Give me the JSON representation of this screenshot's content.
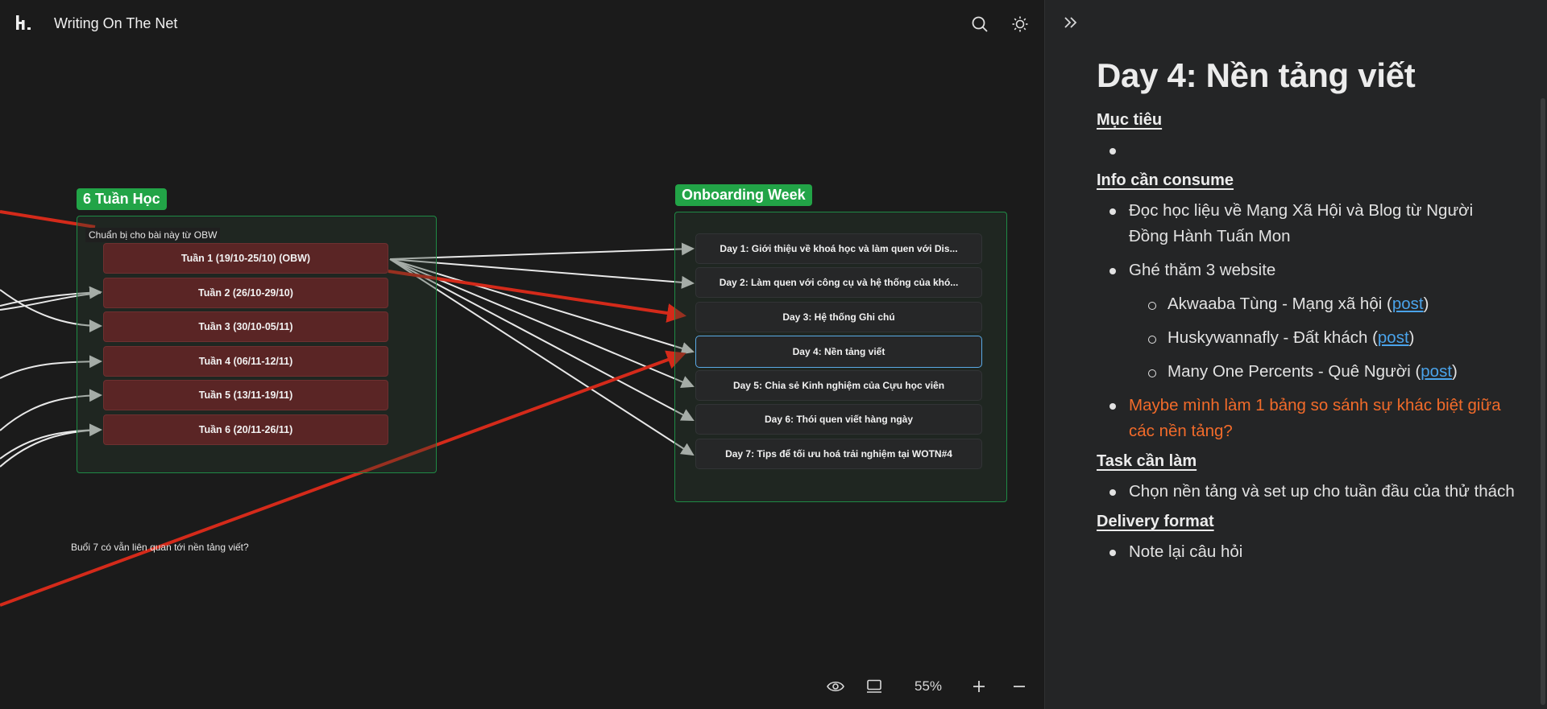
{
  "app": {
    "title": "Writing On The Net"
  },
  "canvas": {
    "groups": [
      {
        "label": "6 Tuần Học"
      },
      {
        "label": "Onboarding Week"
      }
    ],
    "note_top": "Chuẩn bị cho bài này từ OBW",
    "note_bottom": "Buổi 7 có vẫn liên quan tới nền tảng viết?",
    "weeks": [
      "Tuần 1 (19/10-25/10) (OBW)",
      "Tuần 2 (26/10-29/10)",
      "Tuần 3 (30/10-05/11)",
      "Tuần 4 (06/11-12/11)",
      "Tuần 5 (13/11-19/11)",
      "Tuần 6 (20/11-26/11)"
    ],
    "days": [
      "Day 1: Giới thiệu về khoá học và làm quen với Dis...",
      "Day 2: Làm quen với công cụ và hệ thống của khó...",
      "Day 3: Hệ thống Ghi chú",
      "Day 4: Nền tảng viết",
      "Day 5: Chia sẻ Kinh nghiệm của Cựu học viên",
      "Day 6: Thói quen viết hàng ngày",
      "Day 7: Tips để tối ưu hoá trải nghiệm tại WOTN#4"
    ],
    "selected_day": "Day 4: Nền tảng viết",
    "colors": {
      "group_border": "#1f8a45",
      "group_label": "#22a447",
      "week_node": "#5a2525",
      "red_arrow": "#d42a1a",
      "selection": "#5aaae6"
    }
  },
  "toolbar": {
    "zoom": "55%"
  },
  "panel": {
    "title": "Day 4: Nền tảng viết",
    "sections": {
      "goal": {
        "heading": "Mục tiêu"
      },
      "consume": {
        "heading": "Info cần consume",
        "item1": "Đọc học liệu về Mạng Xã Hội và Blog từ Người Đồng Hành Tuấn Mon",
        "item2": "Ghé thăm 3 website",
        "sub": [
          {
            "text": "Akwaaba Tùng - Mạng xã hội (",
            "link": "post",
            "tail": ")"
          },
          {
            "text": "Huskywannafly - Đất khách (",
            "link": "post",
            "tail": ")"
          },
          {
            "text": "Many One Percents - Quê Người (",
            "link": "post",
            "tail": ")"
          }
        ],
        "item3": "Maybe mình làm 1 bảng so sánh sự khác biệt giữa các nền tảng?"
      },
      "task": {
        "heading": "Task cần làm",
        "item1": "Chọn nền tảng và set up cho tuần đầu của thử thách"
      },
      "delivery": {
        "heading": "Delivery format",
        "item1": "Note lại câu hỏi"
      }
    },
    "link_color": "#4aa3ea",
    "highlight_color": "#f26b2a"
  }
}
